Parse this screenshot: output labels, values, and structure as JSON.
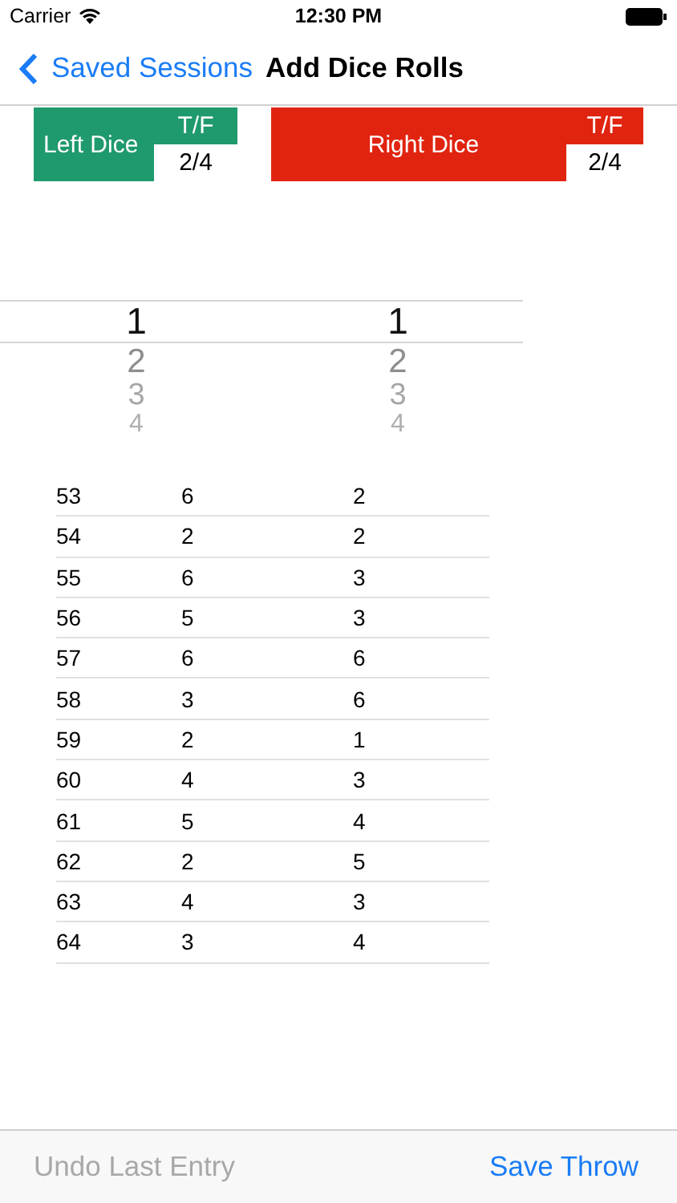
{
  "status_bar": {
    "carrier": "Carrier",
    "time": "12:30 PM"
  },
  "nav_bar": {
    "back_label": "Saved Sessions",
    "title": "Add Dice Rolls"
  },
  "dice": [
    {
      "label": "Left Dice",
      "header": "T/F",
      "score": "2/4",
      "color": "#1f9a6d"
    },
    {
      "label": "Right Dice",
      "header": "T/F",
      "score": "2/4",
      "color": "#e02410"
    }
  ],
  "picker": {
    "columns": [
      {
        "options": [
          {
            "label": "1",
            "selected": true
          },
          {
            "label": "2",
            "selected": false
          },
          {
            "label": "3",
            "selected": false
          },
          {
            "label": "4",
            "selected": false
          }
        ]
      },
      {
        "options": [
          {
            "label": "1",
            "selected": true
          },
          {
            "label": "2",
            "selected": false
          },
          {
            "label": "3",
            "selected": false
          },
          {
            "label": "4",
            "selected": false
          }
        ]
      }
    ]
  },
  "rolls": [
    [
      "53",
      "6",
      "2"
    ],
    [
      "54",
      "2",
      "2"
    ],
    [
      "55",
      "6",
      "3"
    ],
    [
      "56",
      "5",
      "3"
    ],
    [
      "57",
      "6",
      "6"
    ],
    [
      "58",
      "3",
      "6"
    ],
    [
      "59",
      "2",
      "1"
    ],
    [
      "60",
      "4",
      "3"
    ],
    [
      "61",
      "5",
      "4"
    ],
    [
      "62",
      "2",
      "5"
    ],
    [
      "63",
      "4",
      "3"
    ],
    [
      "64",
      "3",
      "4"
    ]
  ],
  "toolbar": {
    "undo": {
      "label": "Undo Last Entry",
      "disabled": true
    },
    "save": {
      "label": "Save Throw",
      "disabled": false
    }
  }
}
